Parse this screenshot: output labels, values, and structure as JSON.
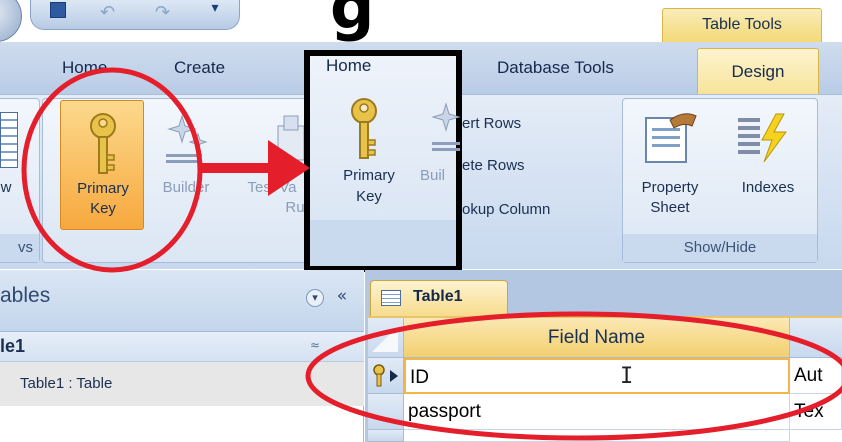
{
  "slide": {
    "title_fragment": "g"
  },
  "qat": {
    "dropdown_glyph": "▾"
  },
  "contextual_tab_group": "Table Tools",
  "tabs": {
    "home": "Home",
    "create": "Create",
    "database_tools": "Database Tools",
    "design": "Design"
  },
  "ribbon": {
    "primary_key": [
      "Primary",
      "Key"
    ],
    "builder": "Builder",
    "test_validation": [
      "Test Va",
      "Ru"
    ],
    "views_group_fragment": "w",
    "views_group_label_fragment": "vs",
    "property_sheet": [
      "Property",
      "Sheet"
    ],
    "indexes": "Indexes",
    "show_hide_label": "Show/Hide",
    "tools_group": {
      "insert_rows": "ert Rows",
      "delete_rows": "ete Rows",
      "lookup_column": "okup Column"
    }
  },
  "callout": {
    "home_fragment": "Home",
    "primary_key": [
      "Primary",
      "Key"
    ],
    "builder_fragment": "Buil"
  },
  "nav_pane": {
    "title": "ables",
    "collapse_glyph": "«",
    "dropdown_glyph": "▾",
    "group": "le1",
    "group_collapse_glyph": "≈",
    "item": "Table1 : Table"
  },
  "document": {
    "tab_label": "Table1",
    "field_name_header": "Field Name",
    "rows": [
      {
        "field_name": "ID",
        "data_type": "Aut",
        "is_primary_key": true
      },
      {
        "field_name": "passport",
        "data_type": "Tex"
      }
    ]
  },
  "colors": {
    "highlight_red": "#e41e2a",
    "callout_black": "#000000",
    "ribbon_orange": "#f7a83e"
  }
}
